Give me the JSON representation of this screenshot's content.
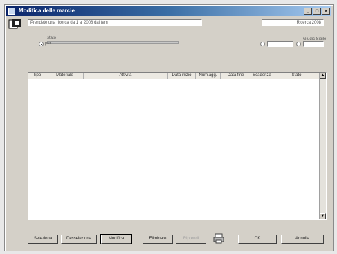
{
  "window": {
    "title": "Modifica delle marcie"
  },
  "header": {
    "search_value": "Prendete una ricerca da 1 al 2008 dal tem",
    "right_value": "Ricerca 2008",
    "slider_label": "stato",
    "radio_label": "per",
    "right_top_label": "Giudic Sibile",
    "mini_field_1": "",
    "mini_field_2": "",
    "mini_field_3": ""
  },
  "table": {
    "columns": [
      "Tipo",
      "Materiale",
      "Attivita",
      "Data inizio",
      "Num.agg.",
      "Data fine",
      "Scadenza",
      "Stato"
    ]
  },
  "footer": {
    "buttons": [
      "Seleziona",
      "Desseleziona",
      "Modifica",
      "Eliminare",
      "Riprendi",
      "OK",
      "Annulla"
    ]
  }
}
